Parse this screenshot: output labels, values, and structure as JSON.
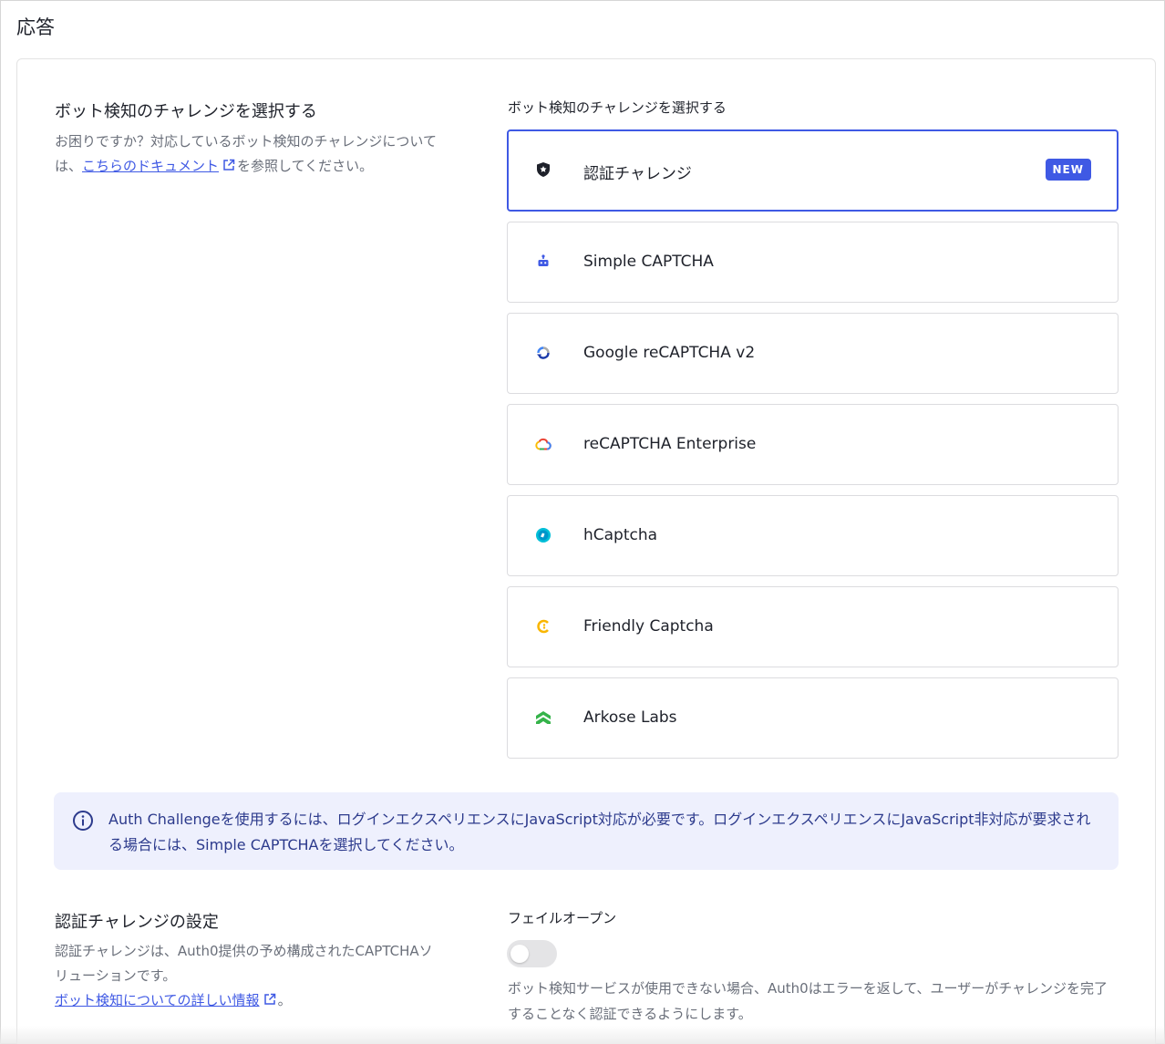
{
  "page": {
    "title": "応答"
  },
  "bot_detection": {
    "title": "ボット検知のチャレンジを選択する",
    "desc_before": "お困りですか？対応しているボット検知のチャレンジについては、",
    "doc_link": "こちらのドキュメント",
    "desc_after": "を参照してください。",
    "field_label": "ボット検知のチャレンジを選択する",
    "selected_index": 0,
    "options": [
      {
        "label": "認証チャレンジ",
        "icon": "shield-icon",
        "badge": "NEW"
      },
      {
        "label": "Simple CAPTCHA",
        "icon": "robot-icon"
      },
      {
        "label": "Google reCAPTCHA v2",
        "icon": "recaptcha-icon"
      },
      {
        "label": "reCAPTCHA Enterprise",
        "icon": "google-cloud-icon"
      },
      {
        "label": "hCaptcha",
        "icon": "hcaptcha-icon"
      },
      {
        "label": "Friendly Captcha",
        "icon": "friendly-captcha-icon"
      },
      {
        "label": "Arkose Labs",
        "icon": "arkose-labs-icon"
      }
    ]
  },
  "info": {
    "icon": "info-icon",
    "text": "Auth Challengeを使用するには、ログインエクスペリエンスにJavaScript対応が必要です。ログインエクスペリエンスにJavaScript非対応が要求される場合には、Simple CAPTCHAを選択してください。"
  },
  "auth_challenge_settings": {
    "title": "認証チャレンジの設定",
    "desc": "認証チャレンジは、Auth0提供の予め構成されたCAPTCHAソリューションです。",
    "link": "ボット検知についての詳しい情報",
    "link_suffix": "。",
    "fail_open_label": "フェイルオープン",
    "fail_open_enabled": false,
    "fail_open_desc": "ボット検知サービスが使用できない場合、Auth0はエラーを返して、ユーザーがチャレンジを完了することなく認証できるようにします。"
  },
  "colors": {
    "accent": "#3f59e4",
    "info_bg": "#eef0fd",
    "info_text": "#2c3a8c"
  }
}
